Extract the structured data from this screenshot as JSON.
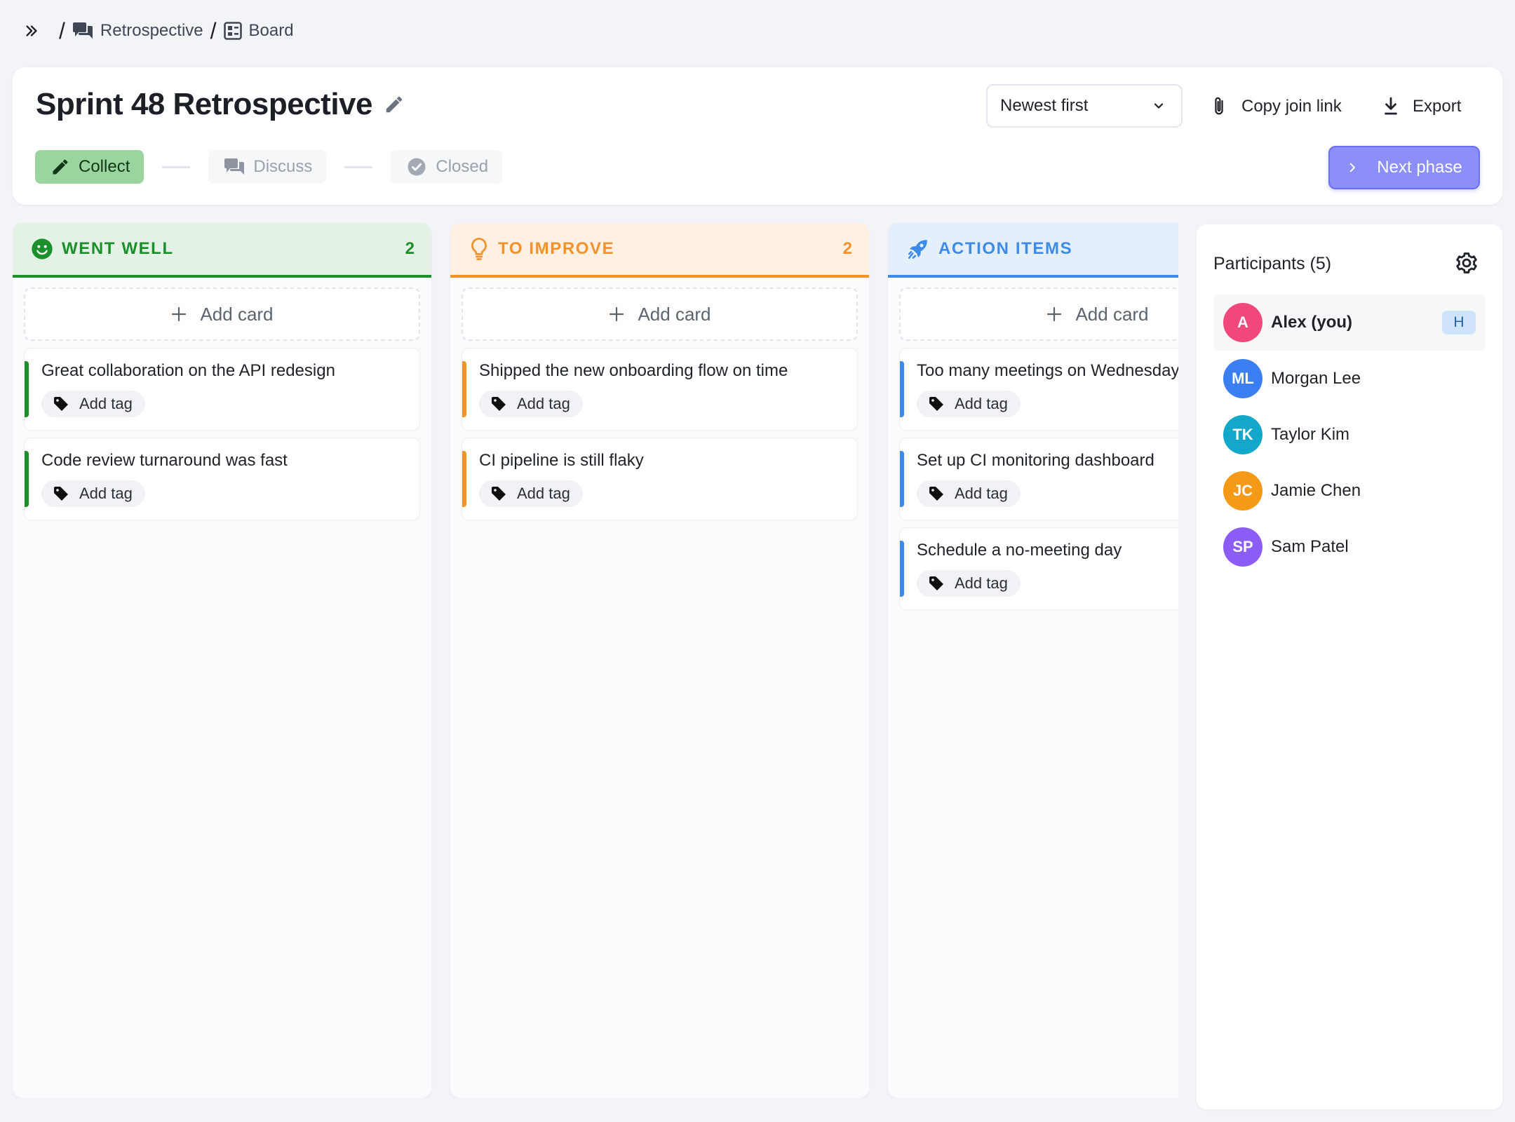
{
  "breadcrumb": {
    "items": [
      {
        "label": "Retrospective",
        "icon": "chat-bubbles-icon"
      },
      {
        "label": "Board",
        "icon": "board-icon"
      }
    ],
    "separator": "/"
  },
  "header": {
    "title": "Sprint 48 Retrospective",
    "sort": {
      "selected": "Newest first"
    },
    "copy_link_label": "Copy join link",
    "export_label": "Export",
    "next_phase_label": "Next phase",
    "phases": [
      {
        "label": "Collect",
        "state": "active"
      },
      {
        "label": "Discuss",
        "state": "inactive"
      },
      {
        "label": "Closed",
        "state": "inactive"
      }
    ]
  },
  "columns": [
    {
      "title": "WENT WELL",
      "count": "2",
      "icon": "smiley-icon",
      "color": "#1a8f2a",
      "head_bg": "#e3f2e4",
      "add_card_label": "Add card",
      "cards": [
        {
          "text": "Great collaboration on the API redesign",
          "tag_label": "Add tag"
        },
        {
          "text": "Code review turnaround was fast",
          "tag_label": "Add tag"
        }
      ]
    },
    {
      "title": "TO IMPROVE",
      "count": "2",
      "icon": "lightbulb-icon",
      "color": "#f3922b",
      "head_bg": "#fff0e2",
      "add_card_label": "Add card",
      "cards": [
        {
          "text": "Shipped the new onboarding flow on time",
          "tag_label": "Add tag"
        },
        {
          "text": "CI pipeline is still flaky",
          "tag_label": "Add tag"
        }
      ]
    },
    {
      "title": "ACTION ITEMS",
      "count": "",
      "icon": "rocket-icon",
      "color": "#3d8be8",
      "head_bg": "#e5effc",
      "add_card_label": "Add card",
      "cards": [
        {
          "text": "Too many meetings on Wednesday",
          "tag_label": "Add tag"
        },
        {
          "text": "Set up CI monitoring dashboard",
          "tag_label": "Add tag"
        },
        {
          "text": "Schedule a no-meeting day",
          "tag_label": "Add tag"
        }
      ]
    }
  ],
  "participants": {
    "title": "Participants (5)",
    "list": [
      {
        "initials": "A",
        "name": "Alex (you)",
        "color": "#f0487a",
        "badge": "H",
        "me": true
      },
      {
        "initials": "ML",
        "name": "Morgan Lee",
        "color": "#3b7ef2"
      },
      {
        "initials": "TK",
        "name": "Taylor Kim",
        "color": "#13a8c9"
      },
      {
        "initials": "JC",
        "name": "Jamie Chen",
        "color": "#f59a16"
      },
      {
        "initials": "SP",
        "name": "Sam Patel",
        "color": "#8b5cf6"
      }
    ]
  }
}
